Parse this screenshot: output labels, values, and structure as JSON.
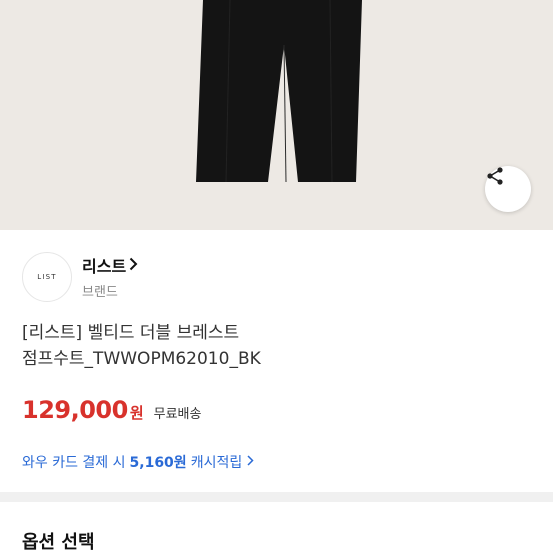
{
  "product_image": {
    "alt": "pants"
  },
  "share": {
    "icon": "share-icon"
  },
  "brand": {
    "logo_text": "LIST",
    "name": "리스트",
    "sub_label": "브랜드"
  },
  "product": {
    "title_line1": "[리스트] 벨티드 더블 브레스트",
    "title_line2": "점프수트_TWWOPM62010_BK"
  },
  "price": {
    "amount": "129,000",
    "unit": "원",
    "shipping": "무료배송"
  },
  "cashback": {
    "prefix": "와우 카드 결제 시",
    "amount": "5,160원",
    "suffix": "캐시적립"
  },
  "options": {
    "title": "옵션 선택"
  },
  "colors": {
    "price": "#d8322c",
    "link": "#2a6ad6",
    "hero_bg": "#ede9e4"
  }
}
